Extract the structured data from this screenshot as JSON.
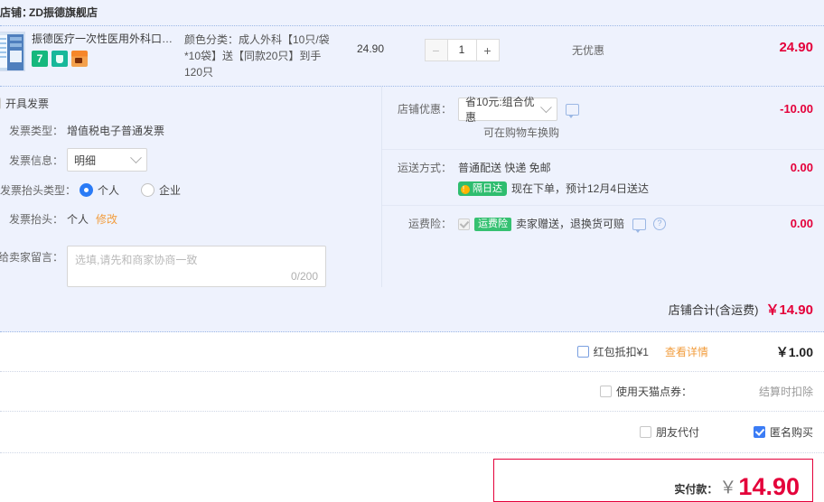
{
  "shop": {
    "label": "店铺：",
    "name": "ZD振德旗舰店"
  },
  "product": {
    "title": "振德医疗一次性医用外科口罩成...",
    "badges": [
      "seven-day-return-icon",
      "genuine-guarantee-icon",
      "credit-card-icon"
    ],
    "badge_text": "7",
    "spec": "颜色分类：成人外科【10只/袋*10袋】送【同款20只】到手120只",
    "unit_price": "24.90",
    "qty": "1",
    "minus_label": "−",
    "plus_label": "+",
    "promo_text": "无优惠",
    "line_total": "24.90"
  },
  "invoice": {
    "toggle_label": "开具发票",
    "toggle_checked": true,
    "type_label": "发票类型：",
    "type_value": "增值税电子普通发票",
    "content_label": "发票信息：",
    "content_value": "明细",
    "title_type_label": "发票抬头类型：",
    "title_type_personal": "个人",
    "title_type_company": "企业",
    "title_label": "发票抬头：",
    "title_value": "个人",
    "title_modify": "修改"
  },
  "message": {
    "label": "给卖家留言：",
    "placeholder": "选填,请先和商家协商一致",
    "counter": "0/200"
  },
  "rows": {
    "shop_discount": {
      "label": "店铺优惠：",
      "select_value": "省10元:组合优惠",
      "note": "可在购物车换购",
      "amount": "-10.00"
    },
    "shipping": {
      "label": "运送方式：",
      "value": "普通配送 快递 免邮",
      "badge": "隔日达",
      "badge_dot": "！",
      "eta": "现在下单，预计12月4日送达",
      "amount": "0.00"
    },
    "freight_insurance": {
      "label": "运费险：",
      "tag": "运费险",
      "desc": "卖家赠送，退换货可赔",
      "amount": "0.00"
    }
  },
  "shop_total": {
    "label": "店铺合计(含运费)",
    "amount": "￥14.90"
  },
  "bottom": {
    "redbag_label": "红包抵扣¥1",
    "redbag_link": "查看详情",
    "redbag_amount": "￥1.00",
    "tmall_point_label": "使用天猫点券：",
    "tmall_point_note": "结算时扣除",
    "friend_pay_label": "朋友代付",
    "anonymous_label": "匿名购买"
  },
  "pay": {
    "label": "实付款：",
    "currency": "￥",
    "amount": "14.90"
  },
  "colors": {
    "accent_red": "#e4003a",
    "panel_bg": "#eef2fd",
    "link_orange": "#f29d3e",
    "green": "#2fbd6f"
  }
}
